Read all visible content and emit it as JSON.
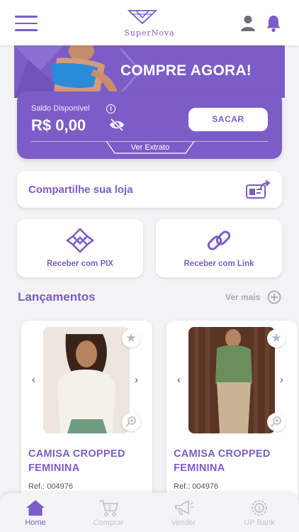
{
  "header": {
    "brand": "SuperNova",
    "menu_icon": "hamburger-menu-icon",
    "user_icon": "user-icon",
    "bell_icon": "bell-icon"
  },
  "banner": {
    "text": "COMPRE AGORA!"
  },
  "balance": {
    "label": "Saldo Disponível",
    "value": "R$ 0,00",
    "withdraw_label": "SACAR",
    "statement_label": "Ver Extrato"
  },
  "share": {
    "label": "Compartilhe sua loja"
  },
  "actions": [
    {
      "label": "Receber com PIX",
      "icon": "pix-icon"
    },
    {
      "label": "Receber com Link",
      "icon": "link-icon"
    }
  ],
  "launches": {
    "title": "Lançamentos",
    "see_more": "Ver mais"
  },
  "products": [
    {
      "name_line1": "CAMISA CROPPED",
      "name_line2": "FEMININA",
      "ref": "Ref.: 004976"
    },
    {
      "name_line1": "CAMISA CROPPED",
      "name_line2": "FEMININA",
      "ref": "Ref.: 004976"
    }
  ],
  "nav": [
    {
      "label": "Home",
      "icon": "home-icon",
      "active": true
    },
    {
      "label": "Comprar",
      "icon": "shopping-cart-icon",
      "active": false
    },
    {
      "label": "Vender",
      "icon": "megaphone-icon",
      "active": false
    },
    {
      "label": "UP Bank",
      "icon": "gear-badge-icon",
      "active": false
    }
  ],
  "colors": {
    "accent": "#7c5dc7",
    "background": "#f3f3f5",
    "inactive": "#c4c4cc"
  }
}
